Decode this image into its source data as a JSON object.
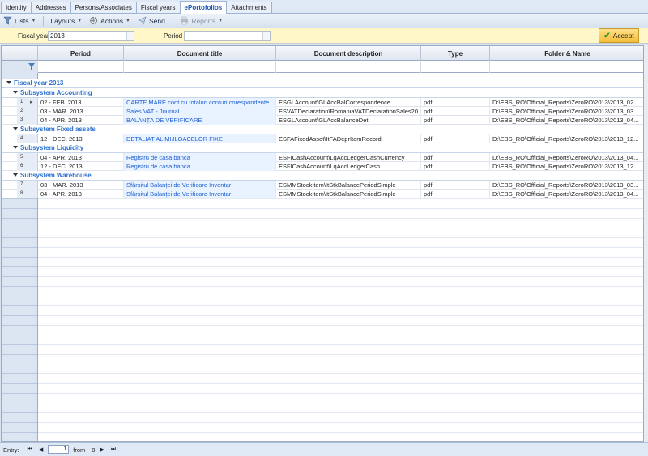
{
  "tabs": [
    "Identity",
    "Addresses",
    "Persons/Associates",
    "Fiscal years",
    "ePortofolios",
    "Attachments"
  ],
  "active_tab": "ePortofolios",
  "toolbar": {
    "lists": "Lists",
    "layouts": "Layouts",
    "actions": "Actions",
    "send": "Send ...",
    "reports": "Reports"
  },
  "params": {
    "fiscal_year_label": "Fiscal year",
    "fiscal_year_value": "2013",
    "period_label": "Period",
    "period_value": "",
    "accept_label": "Accept"
  },
  "columns": {
    "period": "Period",
    "title": "Document title",
    "description": "Document description",
    "type": "Type",
    "folder": "Folder & Name"
  },
  "groups": {
    "fiscal": "Fiscal year  2013",
    "accounting": "Subsystem  Accounting",
    "fixed": "Subsystem  Fixed assets",
    "liquidity": "Subsystem  Liquidity",
    "warehouse": "Subsystem  Warehouse"
  },
  "rows": [
    {
      "n": "1",
      "period": "02 - FEB. 2013",
      "title": "CARTE MARE cont cu totaluri conturi corespondente",
      "desc": "ESGLAccount\\GLAccBalCorrespondence",
      "type": "pdf",
      "folder": "D:\\EBS_RO\\Official_Reports\\ZeroRO\\2013\\2013_02..."
    },
    {
      "n": "2",
      "period": "03 - MAR. 2013",
      "title": "Sales VAT - Journal",
      "desc": "ESVATDeclaration\\RomaniaVATDeclarationSales20...",
      "type": "pdf",
      "folder": "D:\\EBS_RO\\Official_Reports\\ZeroRO\\2013\\2013_03..."
    },
    {
      "n": "3",
      "period": "04 - APR. 2013",
      "title": "BALANȚA DE VERIFICARE",
      "desc": "ESGLAccount\\GLAccBalanceDet",
      "type": "pdf",
      "folder": "D:\\EBS_RO\\Official_Reports\\ZeroRO\\2013\\2013_04..."
    },
    {
      "n": "4",
      "period": "12 - DEC. 2013",
      "title": "DETALIAT AL MIJLOACELOR FIXE",
      "desc": "ESFAFixedAsset\\ItFADeprItemRecord",
      "type": "pdf",
      "folder": "D:\\EBS_RO\\Official_Reports\\ZeroRO\\2013\\2013_12..."
    },
    {
      "n": "5",
      "period": "04 - APR. 2013",
      "title": "Registru de casa banca",
      "desc": "ESFICashAccount\\LqAccLedgerCashCurrency",
      "type": "pdf",
      "folder": "D:\\EBS_RO\\Official_Reports\\ZeroRO\\2013\\2013_04..."
    },
    {
      "n": "6",
      "period": "12 - DEC. 2013",
      "title": "Registru de casa banca",
      "desc": "ESFICashAccount\\LqAccLedgerCash",
      "type": "pdf",
      "folder": "D:\\EBS_RO\\Official_Reports\\ZeroRO\\2013\\2013_12..."
    },
    {
      "n": "7",
      "period": "03 - MAR. 2013",
      "title": "Sfârșitul Balanței de Verificare Inventar",
      "desc": "ESMMStockItem\\ItStkBalancePeriodSimple",
      "type": "pdf",
      "folder": "D:\\EBS_RO\\Official_Reports\\ZeroRO\\2013\\2013_03..."
    },
    {
      "n": "8",
      "period": "04 - APR. 2013",
      "title": "Sfârșitul Balanței de Verificare Inventar",
      "desc": "ESMMStockItem\\ItStkBalancePeriodSimple",
      "type": "pdf",
      "folder": "D:\\EBS_RO\\Official_Reports\\ZeroRO\\2013\\2013_04..."
    }
  ],
  "status": {
    "entry_label": "Entry:",
    "current": "1",
    "from_label": "from",
    "total": "8"
  },
  "colors": {
    "accent": "#2a6fcf",
    "param_bar": "#fff7c7",
    "accept_button": "#f5be3a"
  }
}
